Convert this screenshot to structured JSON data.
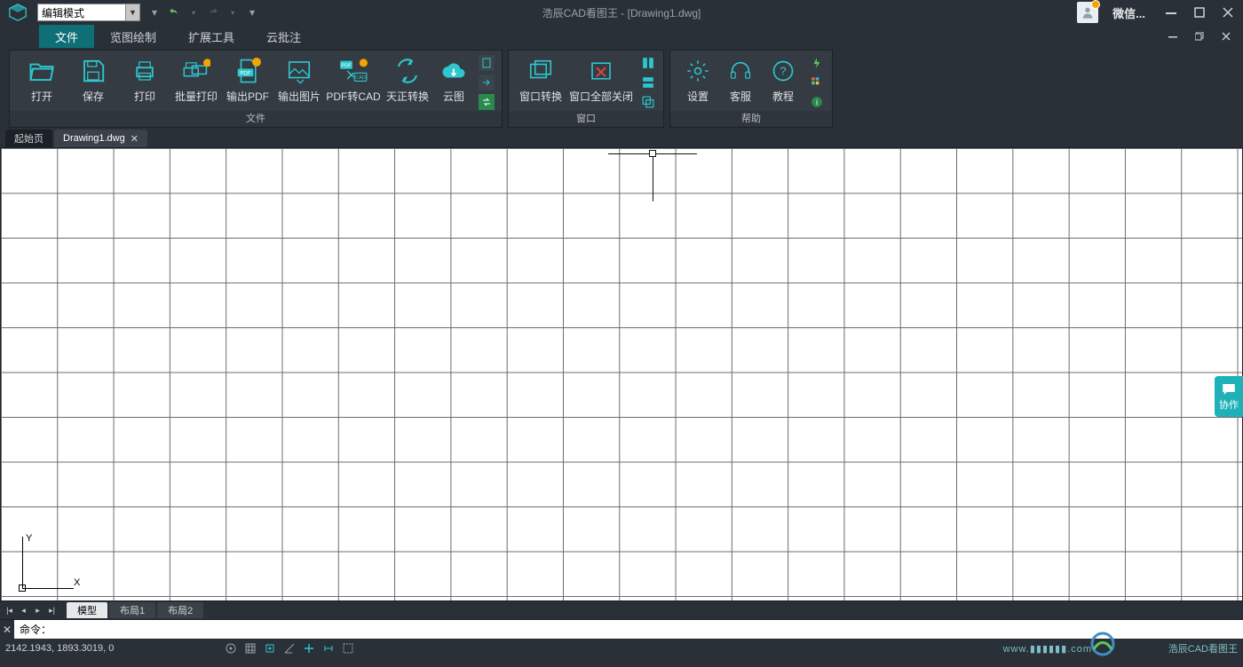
{
  "titlebar": {
    "mode": "编辑模式",
    "title": "浩辰CAD看图王 - [Drawing1.dwg]",
    "wechat": "微信..."
  },
  "menus": {
    "file": "文件",
    "browse": "览图绘制",
    "tools": "扩展工具",
    "annotate": "云批注"
  },
  "ribbon": {
    "file_panel": "文件",
    "window_panel": "窗口",
    "help_panel": "帮助",
    "open": "打开",
    "save": "保存",
    "print": "打印",
    "batch_print": "批量打印",
    "export_pdf": "输出PDF",
    "export_img": "输出图片",
    "pdf2cad": "PDF转CAD",
    "tz_convert": "天正转换",
    "cloud": "云图",
    "win_switch": "窗口转换",
    "win_close_all": "窗口全部关闭",
    "settings": "设置",
    "cs": "客服",
    "tutorial": "教程"
  },
  "doctabs": {
    "start": "起始页",
    "drawing": "Drawing1.dwg"
  },
  "layout": {
    "model": "模型",
    "layout1": "布局1",
    "layout2": "布局2"
  },
  "cmd": {
    "prompt": "命令："
  },
  "status": {
    "coords": "2142.1943, 1893.3019, 0",
    "watermark_right": "浩辰CAD看图王",
    "watermark_url": "www.▮▮▮▮▮▮.com"
  },
  "side": {
    "collab": "协作"
  },
  "ucs": {
    "x": "X",
    "y": "Y"
  }
}
